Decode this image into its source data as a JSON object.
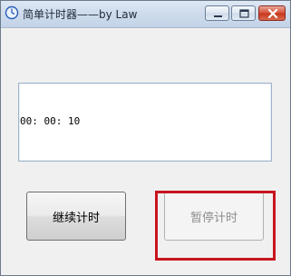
{
  "window": {
    "title": "简单计时器——by Law",
    "icon": "clock-icon",
    "controls": {
      "minimize": "minimize-icon",
      "maximize": "maximize-icon",
      "close": "close-icon"
    }
  },
  "timer": {
    "display": "00: 00: 10"
  },
  "buttons": {
    "continue_label": "继续计时",
    "pause_label": "暂停计时",
    "pause_enabled": false
  },
  "colors": {
    "highlight": "#c8141e",
    "close_button": "#c7391f"
  }
}
